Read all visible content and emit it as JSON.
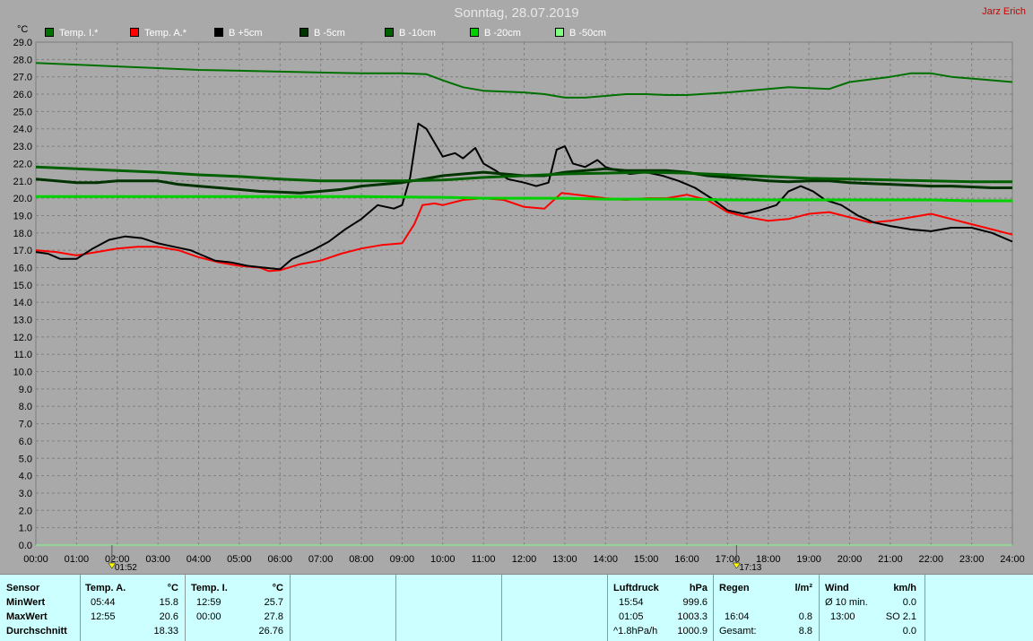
{
  "window": {
    "title": "Sonntag, 28.07.2019",
    "author": "Jarz Erich"
  },
  "chart_data": {
    "type": "line",
    "ylabel": "°C",
    "ylim": [
      0,
      29
    ],
    "y_ticks": [
      "0.0",
      "1.0",
      "2.0",
      "3.0",
      "4.0",
      "5.0",
      "6.0",
      "7.0",
      "8.0",
      "9.0",
      "10.0",
      "11.0",
      "12.0",
      "13.0",
      "14.0",
      "15.0",
      "16.0",
      "17.0",
      "18.0",
      "19.0",
      "20.0",
      "21.0",
      "22.0",
      "23.0",
      "24.0",
      "25.0",
      "26.0",
      "27.0",
      "28.0",
      "29.0"
    ],
    "xlim": [
      0,
      24
    ],
    "x_ticks": [
      "00:00",
      "01:00",
      "02:00",
      "03:00",
      "04:00",
      "05:00",
      "06:00",
      "07:00",
      "08:00",
      "09:00",
      "10:00",
      "11:00",
      "12:00",
      "13:00",
      "14:00",
      "15:00",
      "16:00",
      "17:00",
      "18:00",
      "19:00",
      "20:00",
      "21:00",
      "22:00",
      "23:00",
      "24:00"
    ],
    "grid": true,
    "legend_position": "top",
    "markers": [
      {
        "label": "01:52",
        "x": 1.87,
        "icon": "sunrise-icon"
      },
      {
        "label": "17:13",
        "x": 17.22,
        "icon": "sunset-icon"
      }
    ],
    "series": [
      {
        "name": "Temp. I.*",
        "color": "#007000",
        "width": 2,
        "points": [
          [
            0,
            27.8
          ],
          [
            1,
            27.7
          ],
          [
            2,
            27.6
          ],
          [
            3,
            27.5
          ],
          [
            4,
            27.4
          ],
          [
            5,
            27.35
          ],
          [
            6,
            27.3
          ],
          [
            7,
            27.25
          ],
          [
            8,
            27.2
          ],
          [
            9,
            27.2
          ],
          [
            9.6,
            27.15
          ],
          [
            10,
            26.8
          ],
          [
            10.5,
            26.4
          ],
          [
            11,
            26.2
          ],
          [
            12,
            26.1
          ],
          [
            12.5,
            26.0
          ],
          [
            13,
            25.8
          ],
          [
            13.5,
            25.8
          ],
          [
            14,
            25.9
          ],
          [
            14.5,
            26.0
          ],
          [
            15,
            26.0
          ],
          [
            15.5,
            25.95
          ],
          [
            16,
            25.95
          ],
          [
            17,
            26.1
          ],
          [
            18,
            26.3
          ],
          [
            18.5,
            26.4
          ],
          [
            19,
            26.35
          ],
          [
            19.5,
            26.3
          ],
          [
            20,
            26.7
          ],
          [
            21,
            27.0
          ],
          [
            21.5,
            27.2
          ],
          [
            22,
            27.2
          ],
          [
            22.5,
            27.0
          ],
          [
            23,
            26.9
          ],
          [
            24,
            26.7
          ]
        ]
      },
      {
        "name": "Temp. A.*",
        "color": "#ff0000",
        "width": 2,
        "points": [
          [
            0,
            17.0
          ],
          [
            0.5,
            16.9
          ],
          [
            1,
            16.7
          ],
          [
            1.5,
            16.9
          ],
          [
            2,
            17.1
          ],
          [
            2.5,
            17.2
          ],
          [
            3,
            17.2
          ],
          [
            3.5,
            17.0
          ],
          [
            4,
            16.6
          ],
          [
            4.5,
            16.3
          ],
          [
            5,
            16.1
          ],
          [
            5.5,
            16.0
          ],
          [
            5.73,
            15.8
          ],
          [
            6,
            15.85
          ],
          [
            6.5,
            16.2
          ],
          [
            7,
            16.4
          ],
          [
            7.5,
            16.8
          ],
          [
            8,
            17.1
          ],
          [
            8.5,
            17.3
          ],
          [
            9,
            17.4
          ],
          [
            9.3,
            18.5
          ],
          [
            9.5,
            19.6
          ],
          [
            9.8,
            19.7
          ],
          [
            10,
            19.6
          ],
          [
            10.5,
            19.9
          ],
          [
            11,
            20.0
          ],
          [
            11.5,
            19.9
          ],
          [
            12,
            19.5
          ],
          [
            12.5,
            19.4
          ],
          [
            12.92,
            20.3
          ],
          [
            13.3,
            20.2
          ],
          [
            14,
            20.0
          ],
          [
            14.5,
            19.9
          ],
          [
            15,
            20.0
          ],
          [
            15.5,
            20.0
          ],
          [
            16,
            20.2
          ],
          [
            16.5,
            19.9
          ],
          [
            17,
            19.2
          ],
          [
            17.5,
            18.9
          ],
          [
            18,
            18.7
          ],
          [
            18.5,
            18.8
          ],
          [
            19,
            19.1
          ],
          [
            19.5,
            19.2
          ],
          [
            20,
            18.9
          ],
          [
            20.5,
            18.6
          ],
          [
            21,
            18.7
          ],
          [
            21.5,
            18.9
          ],
          [
            22,
            19.1
          ],
          [
            22.5,
            18.8
          ],
          [
            23,
            18.5
          ],
          [
            23.5,
            18.2
          ],
          [
            24,
            17.9
          ]
        ]
      },
      {
        "name": "B +5cm",
        "color": "#000000",
        "width": 2,
        "points": [
          [
            0,
            16.9
          ],
          [
            0.3,
            16.8
          ],
          [
            0.6,
            16.5
          ],
          [
            1,
            16.5
          ],
          [
            1.4,
            17.1
          ],
          [
            1.8,
            17.6
          ],
          [
            2.2,
            17.8
          ],
          [
            2.6,
            17.7
          ],
          [
            3,
            17.4
          ],
          [
            3.4,
            17.2
          ],
          [
            3.8,
            17.0
          ],
          [
            4,
            16.8
          ],
          [
            4.4,
            16.4
          ],
          [
            4.8,
            16.3
          ],
          [
            5.2,
            16.1
          ],
          [
            5.6,
            16.0
          ],
          [
            6,
            15.9
          ],
          [
            6.3,
            16.5
          ],
          [
            6.8,
            17.0
          ],
          [
            7.2,
            17.5
          ],
          [
            7.6,
            18.2
          ],
          [
            8,
            18.8
          ],
          [
            8.4,
            19.6
          ],
          [
            8.8,
            19.4
          ],
          [
            9,
            19.6
          ],
          [
            9.2,
            21.2
          ],
          [
            9.4,
            24.3
          ],
          [
            9.6,
            24.0
          ],
          [
            10,
            22.4
          ],
          [
            10.3,
            22.6
          ],
          [
            10.5,
            22.3
          ],
          [
            10.8,
            22.9
          ],
          [
            11,
            22.0
          ],
          [
            11.3,
            21.6
          ],
          [
            11.6,
            21.1
          ],
          [
            12,
            20.9
          ],
          [
            12.3,
            20.7
          ],
          [
            12.6,
            20.9
          ],
          [
            12.8,
            22.8
          ],
          [
            13,
            23.0
          ],
          [
            13.2,
            22.0
          ],
          [
            13.5,
            21.8
          ],
          [
            13.8,
            22.2
          ],
          [
            14,
            21.8
          ],
          [
            14.3,
            21.6
          ],
          [
            14.6,
            21.4
          ],
          [
            15,
            21.5
          ],
          [
            15.4,
            21.3
          ],
          [
            15.8,
            21.0
          ],
          [
            16.2,
            20.6
          ],
          [
            16.6,
            20.0
          ],
          [
            17,
            19.3
          ],
          [
            17.4,
            19.1
          ],
          [
            17.8,
            19.3
          ],
          [
            18.2,
            19.6
          ],
          [
            18.5,
            20.4
          ],
          [
            18.8,
            20.7
          ],
          [
            19.1,
            20.4
          ],
          [
            19.4,
            19.9
          ],
          [
            19.8,
            19.6
          ],
          [
            20.2,
            19.0
          ],
          [
            20.6,
            18.6
          ],
          [
            21,
            18.4
          ],
          [
            21.5,
            18.2
          ],
          [
            22,
            18.1
          ],
          [
            22.5,
            18.3
          ],
          [
            23,
            18.3
          ],
          [
            23.5,
            18.0
          ],
          [
            24,
            17.5
          ]
        ]
      },
      {
        "name": "B -5cm",
        "color": "#003300",
        "width": 3,
        "points": [
          [
            0,
            21.1
          ],
          [
            0.5,
            21.0
          ],
          [
            1,
            20.9
          ],
          [
            1.5,
            20.9
          ],
          [
            2,
            21.0
          ],
          [
            3,
            21.0
          ],
          [
            3.5,
            20.8
          ],
          [
            4,
            20.7
          ],
          [
            4.5,
            20.6
          ],
          [
            5,
            20.5
          ],
          [
            5.5,
            20.4
          ],
          [
            6,
            20.35
          ],
          [
            6.5,
            20.3
          ],
          [
            7,
            20.4
          ],
          [
            7.5,
            20.5
          ],
          [
            8,
            20.7
          ],
          [
            8.5,
            20.8
          ],
          [
            9,
            20.9
          ],
          [
            9.5,
            21.1
          ],
          [
            10,
            21.3
          ],
          [
            10.5,
            21.4
          ],
          [
            11,
            21.5
          ],
          [
            11.5,
            21.4
          ],
          [
            12,
            21.3
          ],
          [
            12.5,
            21.3
          ],
          [
            13,
            21.5
          ],
          [
            13.5,
            21.6
          ],
          [
            14,
            21.7
          ],
          [
            14.5,
            21.6
          ],
          [
            15,
            21.6
          ],
          [
            15.5,
            21.6
          ],
          [
            16,
            21.5
          ],
          [
            16.5,
            21.3
          ],
          [
            17,
            21.2
          ],
          [
            17.5,
            21.1
          ],
          [
            18,
            21.0
          ],
          [
            18.5,
            20.95
          ],
          [
            19,
            21.0
          ],
          [
            19.5,
            21.0
          ],
          [
            20,
            20.9
          ],
          [
            20.5,
            20.85
          ],
          [
            21,
            20.8
          ],
          [
            21.5,
            20.75
          ],
          [
            22,
            20.7
          ],
          [
            22.5,
            20.7
          ],
          [
            23,
            20.65
          ],
          [
            23.5,
            20.6
          ],
          [
            24,
            20.6
          ]
        ]
      },
      {
        "name": "B -10cm",
        "color": "#006000",
        "width": 3,
        "points": [
          [
            0,
            21.8
          ],
          [
            1,
            21.7
          ],
          [
            2,
            21.6
          ],
          [
            3,
            21.5
          ],
          [
            4,
            21.35
          ],
          [
            5,
            21.25
          ],
          [
            6,
            21.1
          ],
          [
            7,
            21.0
          ],
          [
            8,
            21.0
          ],
          [
            9,
            21.0
          ],
          [
            10,
            21.05
          ],
          [
            11,
            21.2
          ],
          [
            12,
            21.3
          ],
          [
            13,
            21.4
          ],
          [
            14,
            21.45
          ],
          [
            15,
            21.5
          ],
          [
            16,
            21.45
          ],
          [
            17,
            21.35
          ],
          [
            18,
            21.25
          ],
          [
            19,
            21.15
          ],
          [
            20,
            21.1
          ],
          [
            21,
            21.05
          ],
          [
            22,
            21.0
          ],
          [
            23,
            20.95
          ],
          [
            24,
            20.95
          ]
        ]
      },
      {
        "name": "B -20cm",
        "color": "#00d000",
        "width": 3,
        "points": [
          [
            0,
            20.1
          ],
          [
            2,
            20.1
          ],
          [
            4,
            20.1
          ],
          [
            6,
            20.1
          ],
          [
            8,
            20.1
          ],
          [
            10,
            20.05
          ],
          [
            11,
            20.0
          ],
          [
            12,
            20.0
          ],
          [
            13,
            20.0
          ],
          [
            14,
            19.95
          ],
          [
            15,
            19.95
          ],
          [
            16,
            19.95
          ],
          [
            17,
            19.9
          ],
          [
            18,
            19.9
          ],
          [
            19,
            19.9
          ],
          [
            20,
            19.9
          ],
          [
            21,
            19.9
          ],
          [
            22,
            19.9
          ],
          [
            23,
            19.85
          ],
          [
            24,
            19.85
          ]
        ]
      },
      {
        "name": "B -50cm",
        "color": "#80ff80",
        "width": 1,
        "points": []
      }
    ]
  },
  "stats": {
    "sensor_header": "Sensor",
    "row_labels": [
      "MinWert",
      "MaxWert",
      "Durchschnitt"
    ],
    "temp_a": {
      "header": "Temp. A.",
      "unit": "°C",
      "min_time": "05:44",
      "min_value": "15.8",
      "max_time": "12:55",
      "max_value": "20.6",
      "avg_value": "18.33"
    },
    "temp_i": {
      "header": "Temp. I.",
      "unit": "°C",
      "min_time": "12:59",
      "min_value": "25.7",
      "max_time": "00:00",
      "max_value": "27.8",
      "avg_value": "26.76"
    },
    "pressure": {
      "header": "Luftdruck",
      "unit": "hPa",
      "min_time": "15:54",
      "min_value": "999.6",
      "max_time": "01:05",
      "max_value": "1003.3",
      "trend_label": "^1.8hPa/h",
      "trend_value": "1000.9"
    },
    "rain": {
      "header": "Regen",
      "unit": "l/m²",
      "max_time": "16:04",
      "max_value": "0.8",
      "total_label": "Gesamt:",
      "total_value": "8.8"
    },
    "wind": {
      "header": "Wind",
      "unit": "km/h",
      "avg_label": "Ø 10 min.",
      "avg_value": "0.0",
      "max_time": "13:00",
      "max_value": "SO 2.1",
      "last_value": "0.0"
    }
  }
}
